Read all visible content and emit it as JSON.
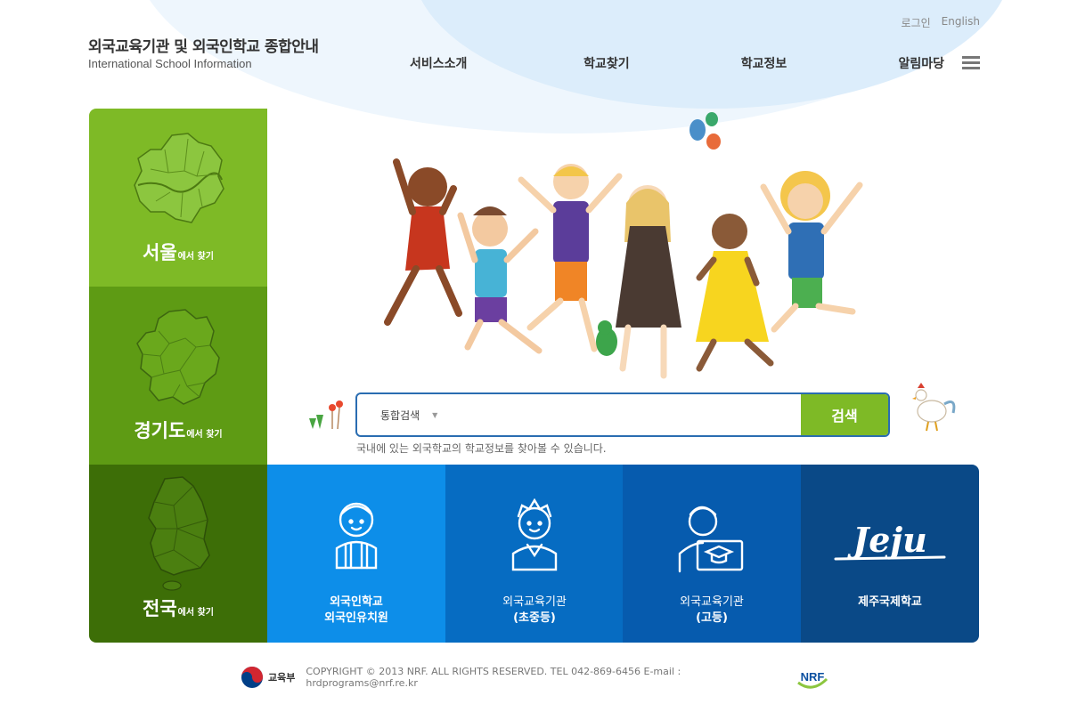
{
  "header": {
    "title_ko": "외국교육기관 및 외국인학교 종합안내",
    "title_en": "International School Information",
    "util": {
      "login": "로그인",
      "english": "English"
    },
    "nav": [
      "서비스소개",
      "학교찾기",
      "학교정보",
      "알림마당"
    ]
  },
  "regions": [
    {
      "name": "서울",
      "suffix": "에서 찾기"
    },
    {
      "name": "경기도",
      "suffix": "에서 찾기"
    },
    {
      "name": "전국",
      "suffix": "에서 찾기"
    }
  ],
  "search": {
    "category": "통합검색",
    "button": "검색",
    "placeholder": "",
    "help": "국내에 있는 외국학교의 학교정보를 찾아볼 수 있습니다."
  },
  "tiles": [
    {
      "line1": "외국인학교",
      "line2": "외국인유치원"
    },
    {
      "line1": "외국교육기관",
      "line2": "(초중등)"
    },
    {
      "line1": "외국교육기관",
      "line2": "(고등)"
    },
    {
      "line1": "제주국제학교",
      "logo": "Jeju"
    }
  ],
  "footer": {
    "ministry": "교육부",
    "copyright": "COPYRIGHT © 2013 NRF. ALL RIGHTS RESERVED. TEL 042-869-6456  E-mail : hrdprograms@nrf.re.kr",
    "org": "NRF"
  },
  "colors": {
    "green_light": "#7eba26",
    "green_mid": "#5e9b14",
    "green_dark": "#3d6e07",
    "blue_1": "#0d8ee9",
    "blue_2": "#066cc2",
    "blue_3": "#065bae",
    "blue_4": "#0a4987",
    "search_border": "#2a6db1"
  }
}
